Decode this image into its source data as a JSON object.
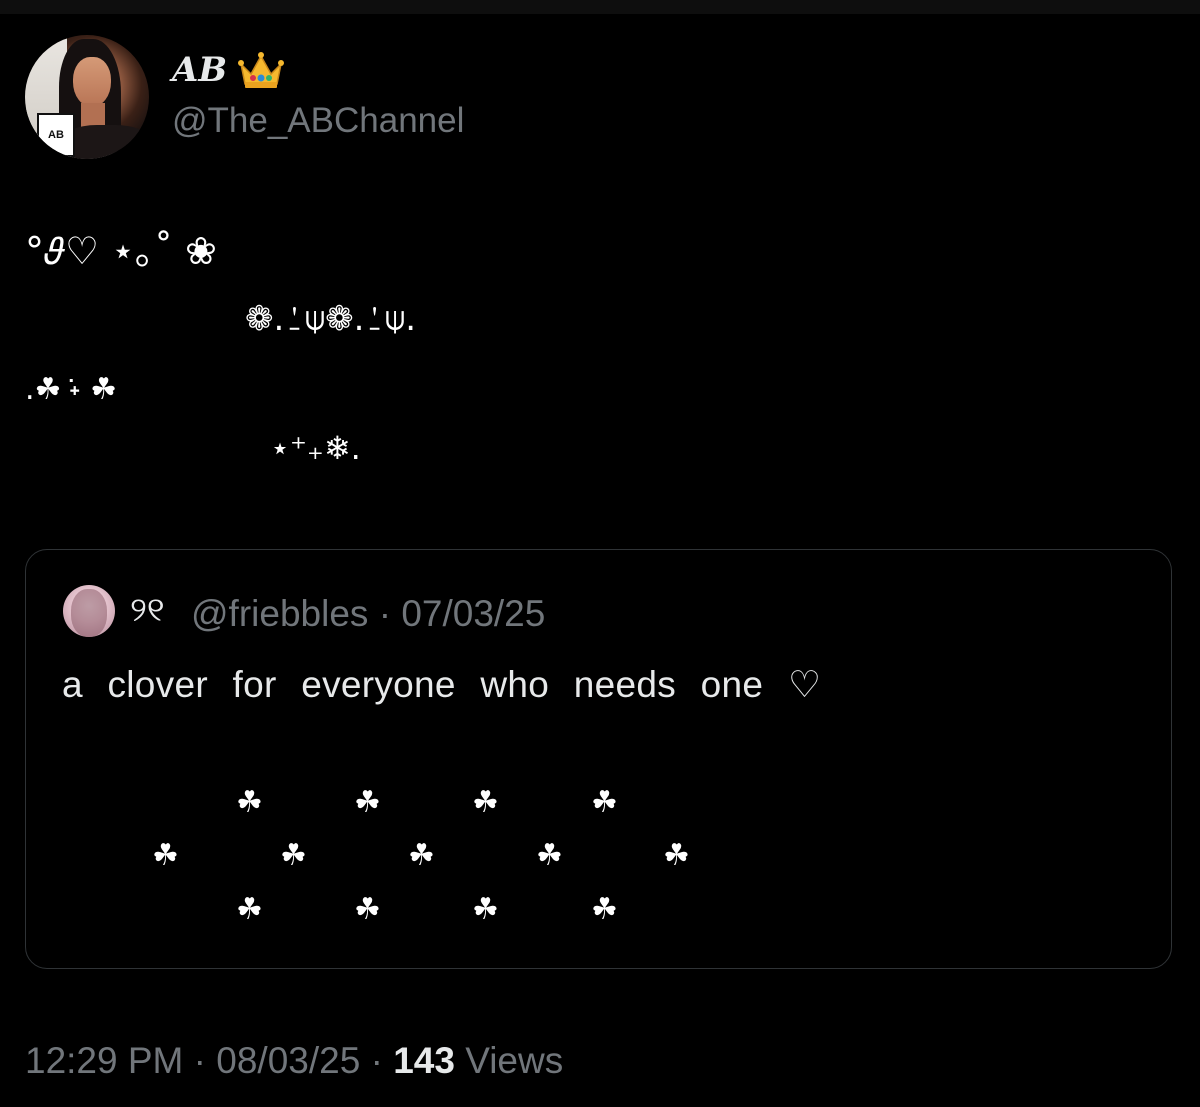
{
  "author": {
    "display_name": "AB",
    "handle": "@The_ABChannel",
    "avatar_label": "AB",
    "badge_icon": "crown-icon"
  },
  "tweet": {
    "lines": [
      "°𝜗♡ ⋆｡˚ ❀",
      "❁.⍘⍦❁.⍘⍦.",
      ".☘︎ ݁˖ ☘︎",
      "⋆⁺₊❄︎."
    ]
  },
  "quote": {
    "name": "୨୧",
    "handle": "@friebbles",
    "date": "07/03/25",
    "text": "a clover for everyone who needs one ♡",
    "clover_glyph": "☘"
  },
  "footer": {
    "time": "12:29 PM",
    "date": "08/03/25",
    "views_count": "143",
    "views_label": "Views",
    "separator": "·"
  },
  "colors": {
    "background": "#000000",
    "text": "#e7e9ea",
    "muted": "#71767b",
    "border": "#2f3336"
  }
}
